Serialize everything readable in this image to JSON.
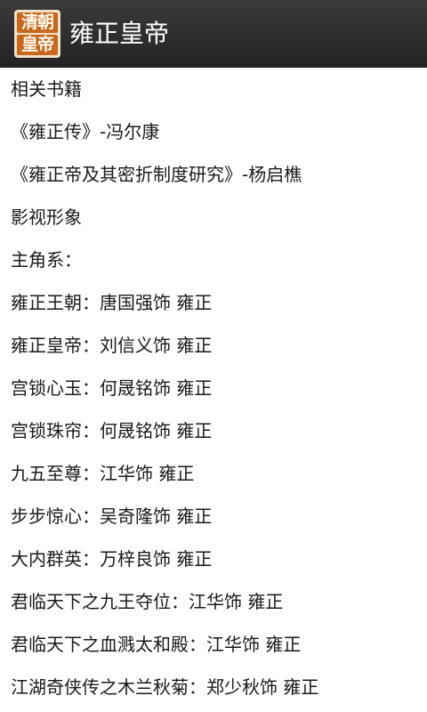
{
  "app": {
    "icon_lines": [
      "清朝",
      "皇帝"
    ],
    "title": "雍正皇帝"
  },
  "content": {
    "lines": [
      "相关书籍",
      "《雍正传》-冯尔康",
      "《雍正帝及其密折制度研究》-杨启樵",
      "影视形象",
      "主角系：",
      "雍正王朝：唐国强饰  雍正",
      "雍正皇帝：刘信义饰  雍正",
      "宫锁心玉：何晟铭饰  雍正",
      "宫锁珠帘：何晟铭饰  雍正",
      "九五至尊：江华饰  雍正",
      "步步惊心：吴奇隆饰  雍正",
      "大内群英：万梓良饰  雍正",
      "君临天下之九王夺位：江华饰  雍正",
      "君临天下之血溅太和殿：江华饰  雍正",
      "江湖奇侠传之木兰秋菊：郑少秋饰  雍正"
    ]
  }
}
